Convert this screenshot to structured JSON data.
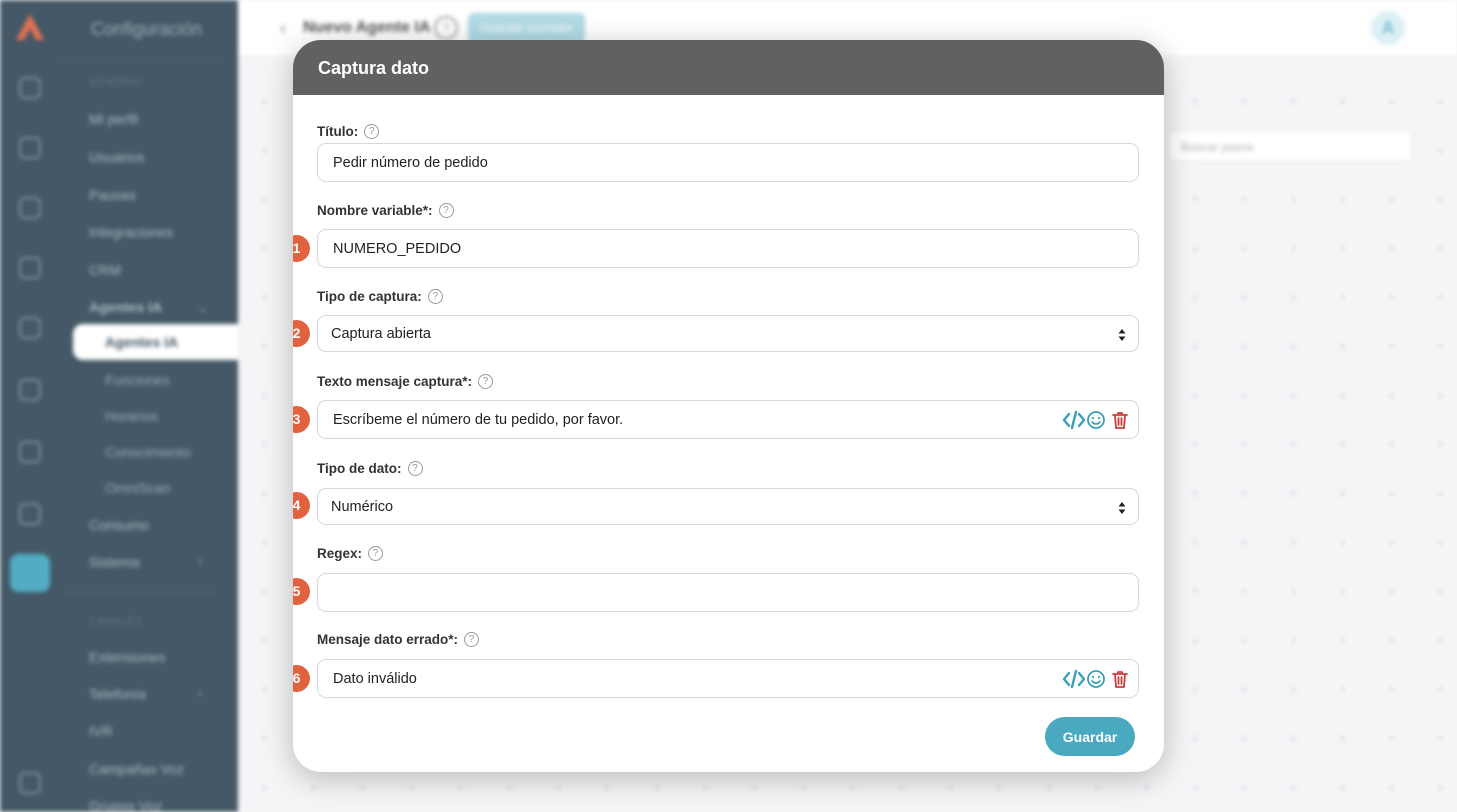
{
  "background": {
    "sidebar": {
      "title": "Configuración",
      "section_general": "GENERAL",
      "items": [
        "Mi perfil",
        "Usuarios",
        "Pausas",
        "Integraciones",
        "CRM",
        "Agentes IA"
      ],
      "sub_items": [
        "Agentes IA",
        "Funciones",
        "Horarios",
        "Conocimiento",
        "OmniScan"
      ],
      "items_after": [
        "Consumo",
        "Sistema"
      ],
      "section_channels": "CANALES",
      "channel_items": [
        "Extensiones",
        "Telefonía",
        "IVR",
        "Campañas Voz",
        "Grupos Voz"
      ]
    },
    "topbar": {
      "title": "Nuevo Agente IA",
      "help": "?",
      "draft_button": "Guardar borrador",
      "avatar": "A"
    },
    "search": {
      "placeholder": "Buscar pasos"
    }
  },
  "modal": {
    "title": "Captura dato",
    "fields": [
      {
        "label": "Título:",
        "value": "Pedir número de pedido",
        "badge": ""
      },
      {
        "label": "Nombre variable*:",
        "value": "NUMERO_PEDIDO",
        "badge": "1"
      },
      {
        "label": "Tipo de captura:",
        "value": "Captura abierta",
        "badge": "2"
      },
      {
        "label": "Texto mensaje captura*:",
        "value": "Escríbeme el número de tu pedido, por favor.",
        "badge": "3"
      },
      {
        "label": "Tipo de dato:",
        "value": "Numérico",
        "badge": "4"
      },
      {
        "label": "Regex:",
        "value": "",
        "badge": "5"
      },
      {
        "label": "Mensaje dato errado*:",
        "value": "Dato inválido",
        "badge": "6"
      }
    ],
    "save_label": "Guardar"
  },
  "colors": {
    "sidebar": "#2f4656",
    "accent": "#48a9c1",
    "badge": "#e0623f",
    "header": "#616161",
    "delete": "#d13b3b"
  }
}
